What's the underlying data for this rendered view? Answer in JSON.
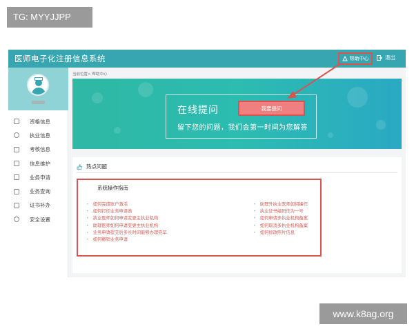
{
  "watermarks": {
    "top_left": "TG: MYYJJPP",
    "bottom_right": "www.k8ag.org"
  },
  "header": {
    "title": "医师电子化注册信息系统",
    "help_label": "帮助中心",
    "logout_label": "退出"
  },
  "breadcrumb": "当前位置> 帮助中心",
  "sidebar": {
    "items": [
      {
        "label": "资格信息",
        "icon": "document-icon"
      },
      {
        "label": "执业信息",
        "icon": "headset-icon"
      },
      {
        "label": "考核信息",
        "icon": "clipboard-icon"
      },
      {
        "label": "信息维护",
        "icon": "edit-icon"
      },
      {
        "label": "业务申请",
        "icon": "apply-icon"
      },
      {
        "label": "业务查询",
        "icon": "query-icon"
      },
      {
        "label": "证书补办",
        "icon": "certificate-icon"
      },
      {
        "label": "安全设置",
        "icon": "user-lock-icon"
      }
    ]
  },
  "banner": {
    "title": "在线提问",
    "button_label": "我要提问",
    "subtitle": "留下您的问题，我们会第一时间为您解答"
  },
  "hot": {
    "heading": "热点问题",
    "guide_title": "系统操作指南",
    "left_questions": [
      "如何完成账户激活",
      "如何打印业务申请表",
      "执业医师如何申请变更主执业机构",
      "助理医师如何申请变更主执业机构",
      "业务申请提交后多长时间能够办理完毕",
      "如何撤销业务申请"
    ],
    "right_questions": [
      "助理升执业医师如何操作",
      "执业证书编码作为一号",
      "如何申请多执业机构备案",
      "如何取消多执业机构备案",
      "如何修改照片信息"
    ]
  },
  "colors": {
    "header": "#37a6b0",
    "highlight": "#d9534f",
    "button": "#f08080",
    "link": "#d0615b"
  }
}
